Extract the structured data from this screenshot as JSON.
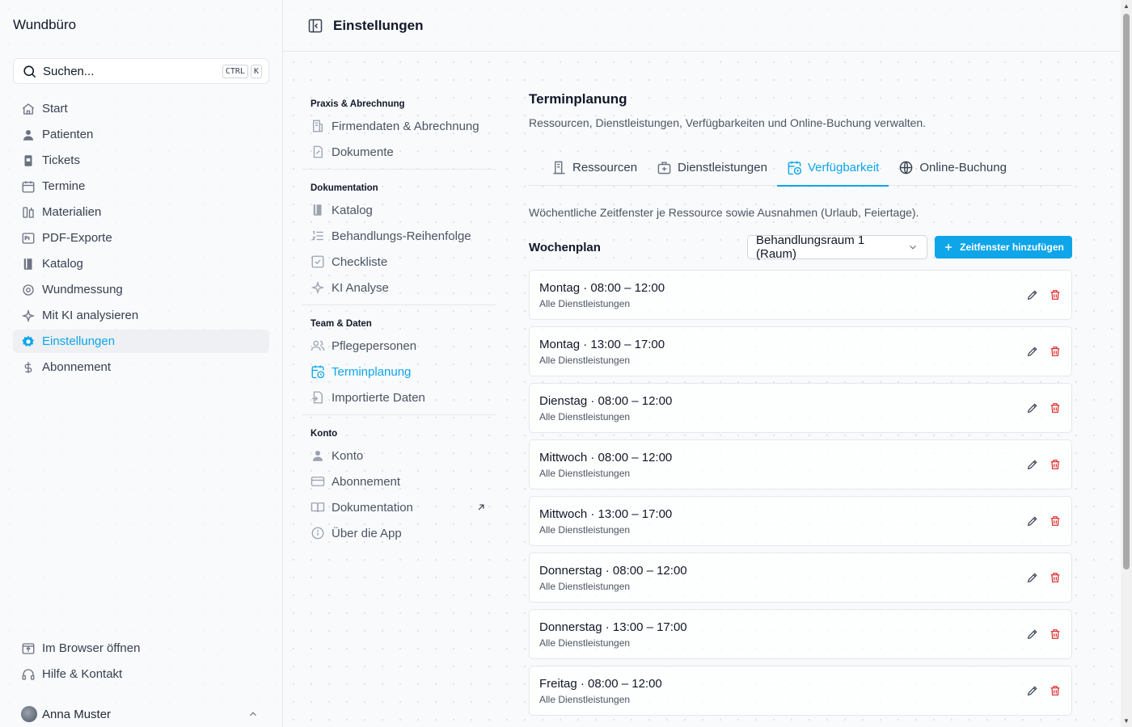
{
  "app": {
    "name": "Wundbüro"
  },
  "search": {
    "placeholder": "Suchen...",
    "kbd1": "CTRL",
    "kbd2": "K"
  },
  "sidebar": {
    "items": [
      {
        "label": "Start",
        "icon": "home-icon"
      },
      {
        "label": "Patienten",
        "icon": "user-icon"
      },
      {
        "label": "Tickets",
        "icon": "ticket-icon"
      },
      {
        "label": "Termine",
        "icon": "calendar-icon"
      },
      {
        "label": "Materialien",
        "icon": "materials-icon"
      },
      {
        "label": "PDF-Exporte",
        "icon": "pdf-icon"
      },
      {
        "label": "Katalog",
        "icon": "book-icon"
      },
      {
        "label": "Wundmessung",
        "icon": "measure-icon"
      },
      {
        "label": "Mit KI analysieren",
        "icon": "sparkles-icon"
      },
      {
        "label": "Einstellungen",
        "icon": "gear-icon",
        "active": true
      },
      {
        "label": "Abonnement",
        "icon": "dollar-icon"
      }
    ],
    "bottom": [
      {
        "label": "Im Browser öffnen",
        "icon": "browser-icon"
      },
      {
        "label": "Hilfe & Kontakt",
        "icon": "headset-icon"
      }
    ],
    "user": {
      "name": "Anna Muster"
    }
  },
  "header": {
    "title": "Einstellungen"
  },
  "settings_nav": {
    "groups": [
      {
        "heading": "Praxis & Abrechnung",
        "items": [
          {
            "label": "Firmendaten & Abrechnung",
            "icon": "building-icon"
          },
          {
            "label": "Dokumente",
            "icon": "document-icon"
          }
        ]
      },
      {
        "heading": "Dokumentation",
        "items": [
          {
            "label": "Katalog",
            "icon": "book-icon"
          },
          {
            "label": "Behandlungs-Reihenfolge",
            "icon": "list-ordered-icon"
          },
          {
            "label": "Checkliste",
            "icon": "checkbox-icon"
          },
          {
            "label": "KI Analyse",
            "icon": "sparkles-icon"
          }
        ]
      },
      {
        "heading": "Team & Daten",
        "items": [
          {
            "label": "Pflegepersonen",
            "icon": "users-icon"
          },
          {
            "label": "Terminplanung",
            "icon": "calendar-clock-icon",
            "active": true
          },
          {
            "label": "Importierte Daten",
            "icon": "import-icon"
          }
        ]
      },
      {
        "heading": "Konto",
        "items": [
          {
            "label": "Konto",
            "icon": "user-icon"
          },
          {
            "label": "Abonnement",
            "icon": "credit-card-icon"
          },
          {
            "label": "Dokumentation",
            "icon": "open-book-icon",
            "external": true
          },
          {
            "label": "Über die App",
            "icon": "info-icon"
          }
        ]
      }
    ]
  },
  "main": {
    "title": "Terminplanung",
    "description": "Ressourcen, Dienstleistungen, Verfügbarkeiten und Online-Buchung verwalten.",
    "tabs": [
      {
        "label": "Ressourcen",
        "icon": "building-icon"
      },
      {
        "label": "Dienstleistungen",
        "icon": "briefcase-medical-icon"
      },
      {
        "label": "Verfügbarkeit",
        "icon": "calendar-clock-icon",
        "active": true
      },
      {
        "label": "Online-Buchung",
        "icon": "globe-icon"
      }
    ],
    "info": "Wöchentliche Zeitfenster je Ressource sowie Ausnahmen (Urlaub, Feiertage).",
    "plan_title": "Wochenplan",
    "resource_select": "Behandlungsraum 1 (Raum)",
    "add_button": "Zeitfenster hinzufügen",
    "slots": [
      {
        "title": "Montag · 08:00 – 12:00",
        "subtitle": "Alle Dienstleistungen"
      },
      {
        "title": "Montag · 13:00 – 17:00",
        "subtitle": "Alle Dienstleistungen"
      },
      {
        "title": "Dienstag · 08:00 – 12:00",
        "subtitle": "Alle Dienstleistungen"
      },
      {
        "title": "Mittwoch · 08:00 – 12:00",
        "subtitle": "Alle Dienstleistungen"
      },
      {
        "title": "Mittwoch · 13:00 – 17:00",
        "subtitle": "Alle Dienstleistungen"
      },
      {
        "title": "Donnerstag · 08:00 – 12:00",
        "subtitle": "Alle Dienstleistungen"
      },
      {
        "title": "Donnerstag · 13:00 – 17:00",
        "subtitle": "Alle Dienstleistungen"
      },
      {
        "title": "Freitag · 08:00 – 12:00",
        "subtitle": "Alle Dienstleistungen"
      }
    ]
  },
  "colors": {
    "accent": "#0ea5e9",
    "danger": "#dc2626",
    "muted": "#6b7280"
  }
}
